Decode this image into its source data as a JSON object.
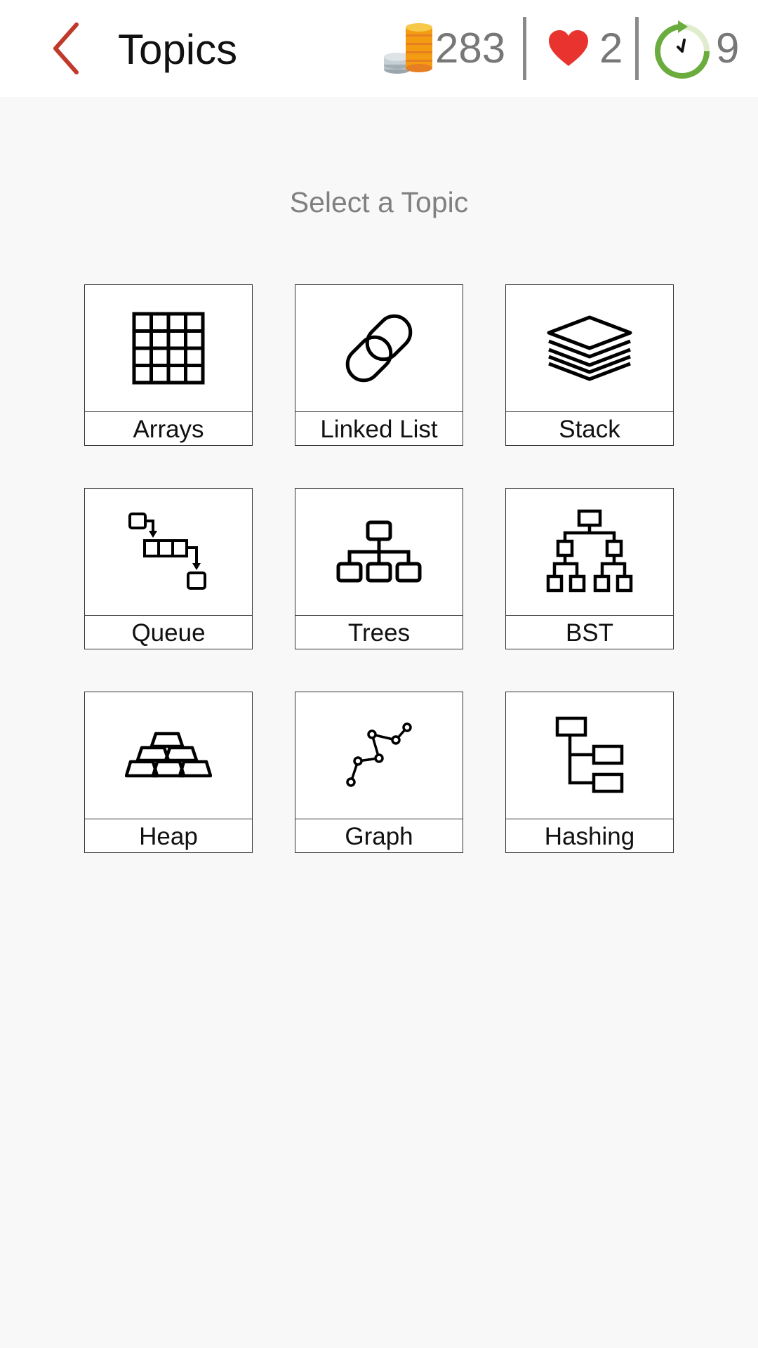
{
  "header": {
    "title": "Topics",
    "back_icon": "chevron-left-icon",
    "coins": "283",
    "lives": "2",
    "timer": "9"
  },
  "colors": {
    "accent": "#c0392b",
    "heart": "#e8332e",
    "timer_ring": "#6aac3e",
    "coin": "#f5a623"
  },
  "subtitle": "Select a Topic",
  "topics": [
    {
      "label": "Arrays",
      "icon": "grid-icon"
    },
    {
      "label": "Linked List",
      "icon": "chain-link-icon"
    },
    {
      "label": "Stack",
      "icon": "layers-icon"
    },
    {
      "label": "Queue",
      "icon": "queue-flow-icon"
    },
    {
      "label": "Trees",
      "icon": "hierarchy-icon"
    },
    {
      "label": "BST",
      "icon": "binary-tree-icon"
    },
    {
      "label": "Heap",
      "icon": "gold-bars-icon"
    },
    {
      "label": "Graph",
      "icon": "line-graph-icon"
    },
    {
      "label": "Hashing",
      "icon": "index-tree-icon"
    }
  ]
}
